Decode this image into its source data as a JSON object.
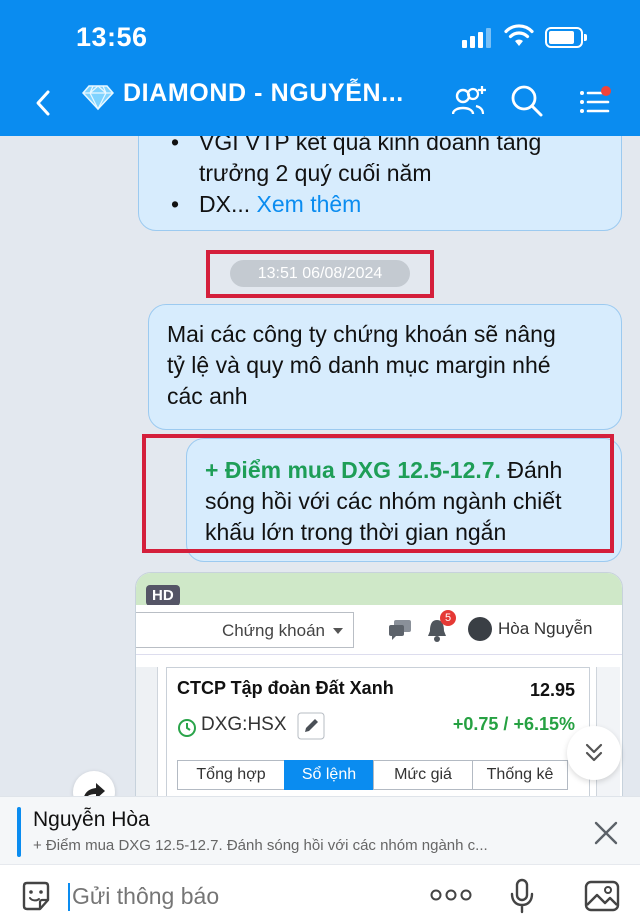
{
  "status_bar": {
    "time": "13:56"
  },
  "header": {
    "title": "DIAMOND - NGUYỄN..."
  },
  "messages": {
    "m1_line1": "VGI VTP kết quả kinh doanh tăng",
    "m1_line2": "trưởng 2 quý cuối năm",
    "m1_bullet2": "DX...",
    "m1_see_more": "Xem thêm",
    "timestamp": "13:51 06/08/2024",
    "m2_line1": "Mai các công ty chứng khoán sẽ nâng",
    "m2_line2": "tỷ lệ và quy mô danh mục margin  nhé",
    "m2_line3": "các anh",
    "m3_green": "+ Điểm mua DXG 12.5-12.7.",
    "m3_rest1": " Đánh",
    "m3_line2": "sóng hồi với các nhóm ngành chiết",
    "m3_line3": "khấu lớn trong thời gian ngắn"
  },
  "image_message": {
    "hd_badge": "HD",
    "select_label": "Chứng khoán",
    "notif_count": "5",
    "user_name": "Hòa Nguyễn",
    "company": "CTCP Tập đoàn Đất Xanh",
    "price": "12.95",
    "ticker": "DXG:HSX",
    "change": "+0.75 / +6.15%",
    "tabs": [
      "Tổng hợp",
      "Sổ lệnh",
      "Mức giá",
      "Thống kê"
    ],
    "active_tab": "Sổ lệnh"
  },
  "reply": {
    "name": "Nguyễn Hòa",
    "text": "+ Điểm mua DXG 12.5-12.7. Đánh sóng hồi với các nhóm ngành c..."
  },
  "composer": {
    "placeholder": "Gửi thông báo"
  },
  "colors": {
    "accent": "#0a8cf0",
    "highlight_border": "#d41f3b",
    "buy_green": "#1e9e57"
  },
  "icons": [
    "back-icon",
    "diamond-icon",
    "add-member-icon",
    "search-icon",
    "menu-icon",
    "forward-icon",
    "scroll-down-icon",
    "close-icon",
    "sticker-icon",
    "more-icon",
    "microphone-icon",
    "image-icon"
  ]
}
